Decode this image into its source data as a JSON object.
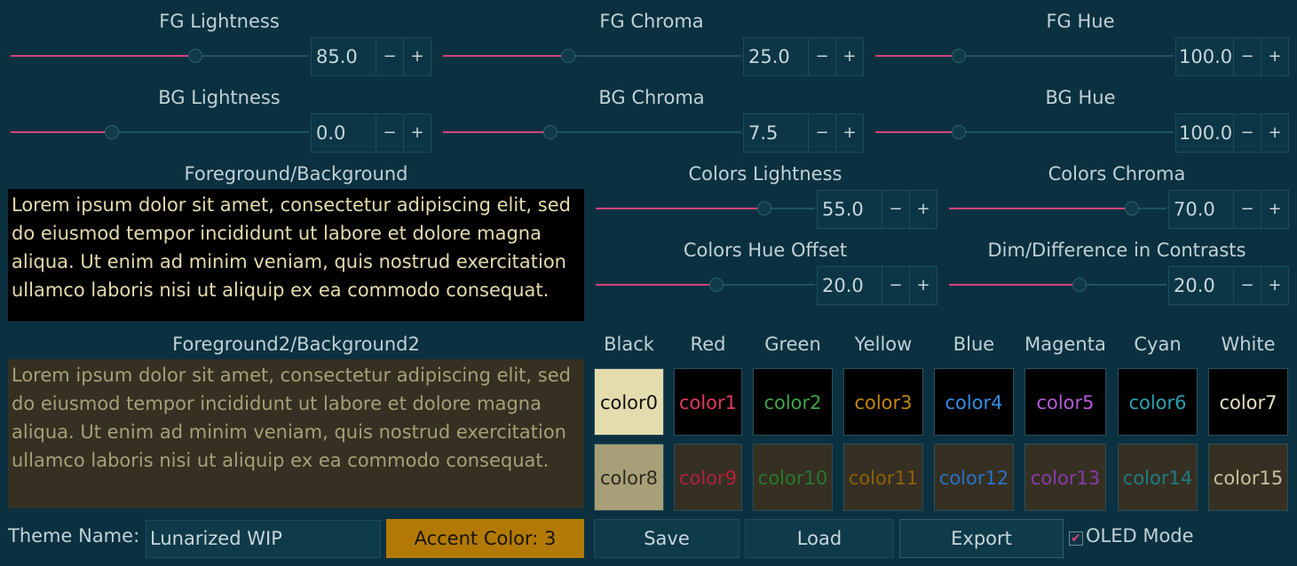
{
  "sliders": {
    "fg_lightness": {
      "label": "FG Lightness",
      "value": "85.0",
      "level": 0.62
    },
    "fg_chroma": {
      "label": "FG Chroma",
      "value": "25.0",
      "level": 0.42
    },
    "fg_hue": {
      "label": "FG Hue",
      "value": "100.0",
      "level": 0.28
    },
    "bg_lightness": {
      "label": "BG Lightness",
      "value": "0.0",
      "level": 0.34
    },
    "bg_chroma": {
      "label": "BG Chroma",
      "value": "7.5",
      "level": 0.36
    },
    "bg_hue": {
      "label": "BG Hue",
      "value": "100.0",
      "level": 0.28
    },
    "colors_lightness": {
      "label": "Colors Lightness",
      "value": "55.0",
      "level": 0.77
    },
    "colors_chroma": {
      "label": "Colors Chroma",
      "value": "70.0",
      "level": 0.84
    },
    "colors_hue_offset": {
      "label": "Colors Hue Offset",
      "value": "20.0",
      "level": 0.55
    },
    "dim_contrasts": {
      "label": "Dim/Difference in Contrasts",
      "value": "20.0",
      "level": 0.6
    }
  },
  "spin": {
    "minus": "−",
    "plus": "+"
  },
  "preview": {
    "fgbg_label": "Foreground/Background",
    "fgbg_text": "Lorem ipsum dolor sit amet, consectetur adipiscing elit, sed do eiusmod tempor incididunt ut labore et dolore magna aliqua. Ut enim ad minim veniam, quis nostrud exercitation ullamco laboris nisi ut aliquip ex ea commodo consequat.",
    "fg2bg2_label": "Foreground2/Background2",
    "fg2bg2_text": "Lorem ipsum dolor sit amet, consectetur adipiscing elit, sed do eiusmod tempor incididunt ut labore et dolore magna aliqua. Ut enim ad minim veniam, quis nostrud exercitation ullamco laboris nisi ut aliquip ex ea commodo consequat."
  },
  "columns": [
    "Black",
    "Red",
    "Green",
    "Yellow",
    "Blue",
    "Magenta",
    "Cyan",
    "White"
  ],
  "swatches_row1": [
    "color0",
    "color1",
    "color2",
    "color3",
    "color4",
    "color5",
    "color6",
    "color7"
  ],
  "swatches_row2": [
    "color8",
    "color9",
    "color10",
    "color11",
    "color12",
    "color13",
    "color14",
    "color15"
  ],
  "colors": {
    "fg": "#e5dcae",
    "bg": "#000000",
    "fg2": "#a89f78",
    "bg2": "#353022",
    "slider_fill": "#d1437a",
    "accent": "#b27a05",
    "row1_text": [
      "#111111",
      "#e03a5a",
      "#3fa54a",
      "#c4860f",
      "#2f8fe6",
      "#b85ad8",
      "#2aa3b2",
      "#e6e0c2"
    ],
    "row2_text": [
      "#2b2a20",
      "#b0223f",
      "#27782e",
      "#8f5e0c",
      "#2a6fc8",
      "#8c3aa8",
      "#1f7c84",
      "#c9c0a0"
    ]
  },
  "footer": {
    "theme_name_label": "Theme Name:",
    "theme_name_value": "Lunarized WIP",
    "accent_button": "Accent Color: 3",
    "save": "Save",
    "load": "Load",
    "export": "Export",
    "oled_label": "OLED Mode",
    "oled_checked": true
  }
}
